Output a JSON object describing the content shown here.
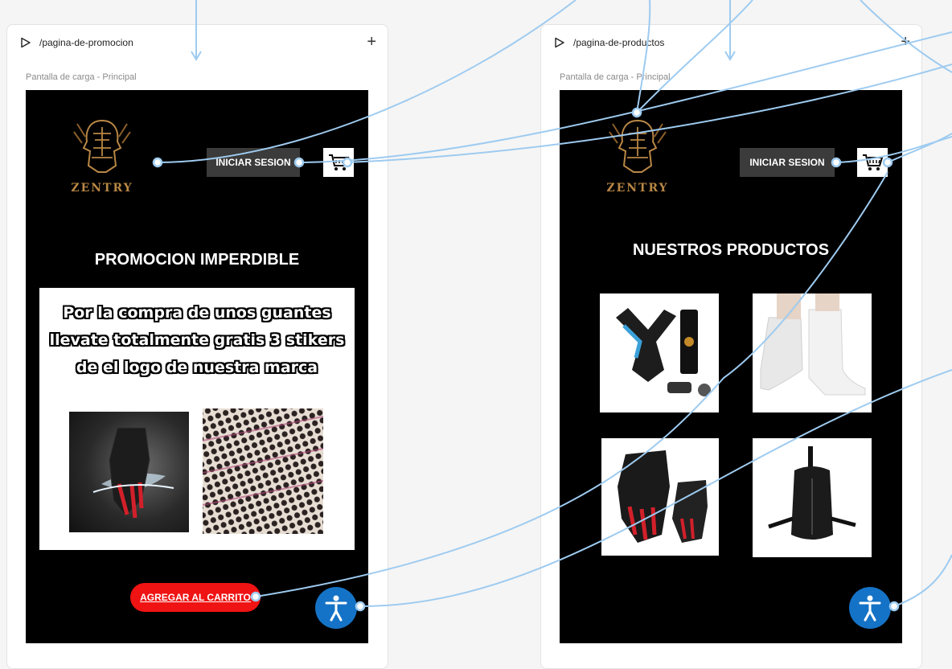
{
  "flows": [
    {
      "name": "/pagina-de-promocion",
      "screen_label": "Pantalla de carga - Principal",
      "logo_text": "ZENTRY",
      "login_label": "INICIAR SESION",
      "heading": "PROMOCION IMPERDIBLE",
      "promo_lines": [
        "Por la compra de unos guantes",
        "llevate totalmente gratis 3 stikers",
        "de el logo de nuestra marca"
      ],
      "add_to_cart_label": "AGREGAR AL CARRITO"
    },
    {
      "name": "/pagina-de-productos",
      "screen_label": "Pantalla de carga - Principal",
      "logo_text": "ZENTRY",
      "login_label": "INICIAR SESION",
      "heading": "NUESTROS PRODUCTOS",
      "products": [
        "helmet-mount",
        "shoe-covers",
        "moto-gloves",
        "sling-bag"
      ]
    }
  ],
  "icons": {
    "play": "play-icon",
    "plus": "plus-icon",
    "cart": "cart-icon",
    "accessibility": "accessibility-icon"
  },
  "colors": {
    "accent_wire": "#9ecbf0",
    "add_cart": "#ef1313",
    "accessibility": "#1573c7"
  }
}
